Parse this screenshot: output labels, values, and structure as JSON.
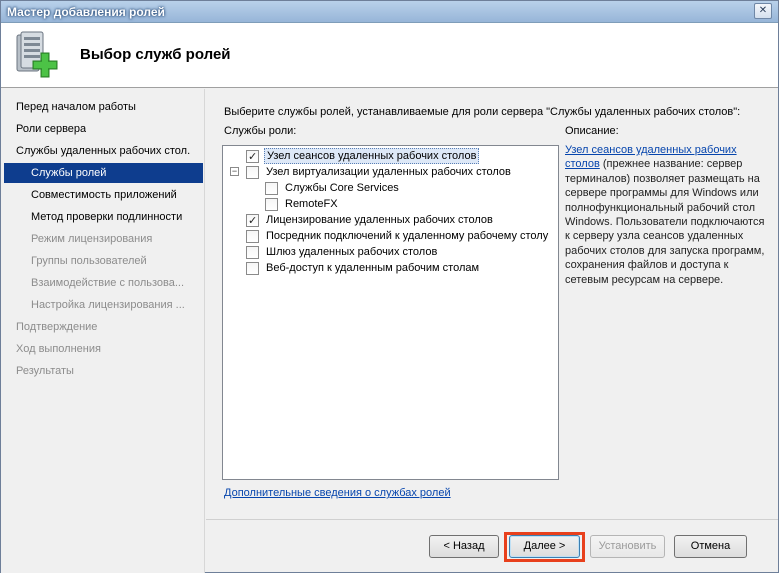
{
  "window": {
    "title": "Мастер добавления ролей",
    "close_glyph": "✕"
  },
  "header": {
    "heading": "Выбор служб ролей",
    "icon": "server-roles-add-icon"
  },
  "sidebar": {
    "items": [
      {
        "label": "Перед началом работы",
        "state": "normal"
      },
      {
        "label": "Роли сервера",
        "state": "normal"
      },
      {
        "label": "Службы удаленных рабочих стол...",
        "state": "normal"
      },
      {
        "label": "Службы ролей",
        "state": "selected"
      },
      {
        "label": "Совместимость приложений",
        "state": "normal"
      },
      {
        "label": "Метод проверки подлинности",
        "state": "normal"
      },
      {
        "label": "Режим лицензирования",
        "state": "dim"
      },
      {
        "label": "Группы пользователей",
        "state": "dim"
      },
      {
        "label": "Взаимодействие с пользова...",
        "state": "dim"
      },
      {
        "label": "Настройка лицензирования ...",
        "state": "dim"
      },
      {
        "label": "Подтверждение",
        "state": "dim"
      },
      {
        "label": "Ход выполнения",
        "state": "dim"
      },
      {
        "label": "Результаты",
        "state": "dim"
      }
    ]
  },
  "content": {
    "intro": "Выберите службы ролей, устанавливаемые для роли сервера \"Службы удаленных рабочих столов\":",
    "roles_label": "Службы роли:",
    "description_label": "Описание:",
    "roles": [
      {
        "label": "Узел сеансов удаленных рабочих столов",
        "checked": true,
        "selected": true
      },
      {
        "label": "Узел виртуализации удаленных рабочих столов",
        "checked": false,
        "expander": "−"
      },
      {
        "label": "Службы Core Services",
        "checked": false
      },
      {
        "label": "RemoteFX",
        "checked": false
      },
      {
        "label": "Лицензирование удаленных рабочих столов",
        "checked": true
      },
      {
        "label": "Посредник подключений к удаленному рабочему столу",
        "checked": false
      },
      {
        "label": "Шлюз удаленных рабочих столов",
        "checked": false
      },
      {
        "label": "Веб-доступ к удаленным рабочим столам",
        "checked": false
      }
    ],
    "check_glyph": "✓",
    "description_link": "Узел сеансов удаленных рабочих столов",
    "description_text": " (прежнее название: сервер терминалов) позволяет размещать на сервере программы для Windows или полнофункциональный рабочий стол Windows. Пользователи подключаются к серверу узла сеансов удаленных рабочих столов для запуска программ, сохранения файлов и доступа к сетевым ресурсам на сервере.",
    "more_link": "Дополнительные сведения о службах ролей"
  },
  "buttons": {
    "back": "< Назад",
    "next": "Далее >",
    "install": "Установить",
    "cancel": "Отмена"
  }
}
